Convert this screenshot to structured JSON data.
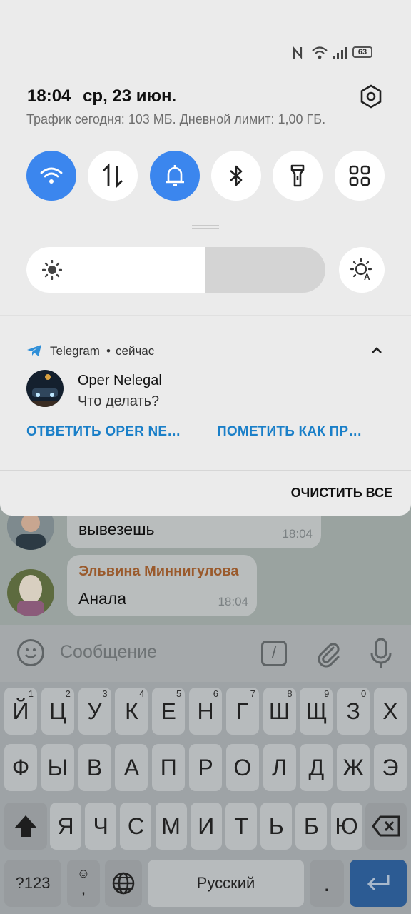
{
  "status_bar": {
    "battery": "63",
    "icons": [
      "nfc-icon",
      "wifi-icon",
      "signal-icon",
      "battery-icon"
    ]
  },
  "shade": {
    "time": "18:04",
    "date": "ср, 23 июн.",
    "traffic": "Трафик сегодня: 103 МБ. Дневной лимит: 1,00 ГБ.",
    "tiles": [
      {
        "name": "wifi-tile",
        "icon": "wifi-icon",
        "active": true
      },
      {
        "name": "mobile-data-tile",
        "icon": "data-arrows-icon",
        "active": false
      },
      {
        "name": "sound-tile",
        "icon": "bell-icon",
        "active": true
      },
      {
        "name": "bluetooth-tile",
        "icon": "bluetooth-icon",
        "active": false
      },
      {
        "name": "flashlight-tile",
        "icon": "flashlight-icon",
        "active": false
      },
      {
        "name": "more-tiles",
        "icon": "grid-icon",
        "active": false
      }
    ],
    "brightness_level": 0.6,
    "accent_color": "#3b86ee"
  },
  "notification": {
    "app": "Telegram",
    "separator": "•",
    "time": "сейчас",
    "title": "Oper Nelegal",
    "text": "Что делать?",
    "action_reply": "ОТВЕТИТЬ OPER NE…",
    "action_mark_read": "ПОМЕТИТЬ КАК ПР…",
    "action_color": "#1a7fc8"
  },
  "clear_all": "ОЧИСТИТЬ ВСЕ",
  "chat": {
    "messages": [
      {
        "text": "вывезешь",
        "time": "18:04"
      },
      {
        "sender": "Эльвина Миннигулова",
        "text": "Анала",
        "time": "18:04"
      }
    ],
    "input_placeholder": "Сообщение",
    "cmd_label": "/"
  },
  "keyboard": {
    "row1": [
      {
        "k": "Й",
        "s": "1"
      },
      {
        "k": "Ц",
        "s": "2"
      },
      {
        "k": "У",
        "s": "3"
      },
      {
        "k": "К",
        "s": "4"
      },
      {
        "k": "Е",
        "s": "5"
      },
      {
        "k": "Н",
        "s": "6"
      },
      {
        "k": "Г",
        "s": "7"
      },
      {
        "k": "Ш",
        "s": "8"
      },
      {
        "k": "Щ",
        "s": "9"
      },
      {
        "k": "З",
        "s": "0"
      },
      {
        "k": "Х",
        "s": ""
      }
    ],
    "row2": [
      "Ф",
      "Ы",
      "В",
      "А",
      "П",
      "Р",
      "О",
      "Л",
      "Д",
      "Ж",
      "Э"
    ],
    "row3": [
      "Я",
      "Ч",
      "С",
      "М",
      "И",
      "Т",
      "Ь",
      "Б",
      "Ю"
    ],
    "symbols_label": "?123",
    "comma_label": ",",
    "space_label": "Русский",
    "period_label": "."
  }
}
